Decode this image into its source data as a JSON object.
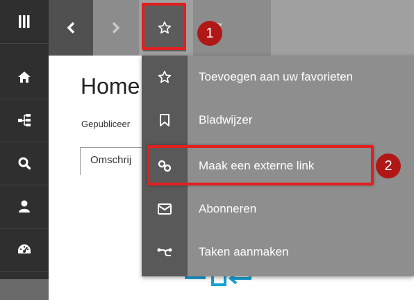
{
  "colors": {
    "sidebar_bg": "#2f2f2f",
    "toolbar_bg": "#a0a0a0",
    "menu_bg": "#8e8e8e",
    "menu_icon_col": "#595959",
    "highlight_red": "#e41e1e",
    "badge_red": "#b01818",
    "flow_accent": "#1aa3d6"
  },
  "sidebar": {
    "items": [
      {
        "icon": "menu-icon"
      },
      {
        "icon": "home-icon"
      },
      {
        "icon": "sitemap-icon"
      },
      {
        "icon": "search-icon"
      },
      {
        "icon": "user-icon"
      },
      {
        "icon": "dashboard-icon"
      }
    ]
  },
  "toolbar": {
    "buttons": [
      {
        "icon": "chevron-left-icon"
      },
      {
        "icon": "chevron-right-icon"
      },
      {
        "icon": "star-icon"
      },
      {
        "icon": "edit-icon"
      }
    ]
  },
  "annotations": {
    "step1": "1",
    "step2": "2"
  },
  "page": {
    "title": "Home",
    "meta": "Gepubliceer",
    "tab_label": "Omschrij"
  },
  "menu": {
    "items": [
      {
        "label": "Toevoegen aan uw favorieten",
        "icon": "star-outline-icon"
      },
      {
        "label": "Bladwijzer",
        "icon": "bookmark-icon"
      },
      {
        "label": "Maak een externe link",
        "icon": "link-icon"
      },
      {
        "label": "Abonneren",
        "icon": "envelope-icon"
      },
      {
        "label": "Taken aanmaken",
        "icon": "workflow-icon"
      }
    ]
  }
}
